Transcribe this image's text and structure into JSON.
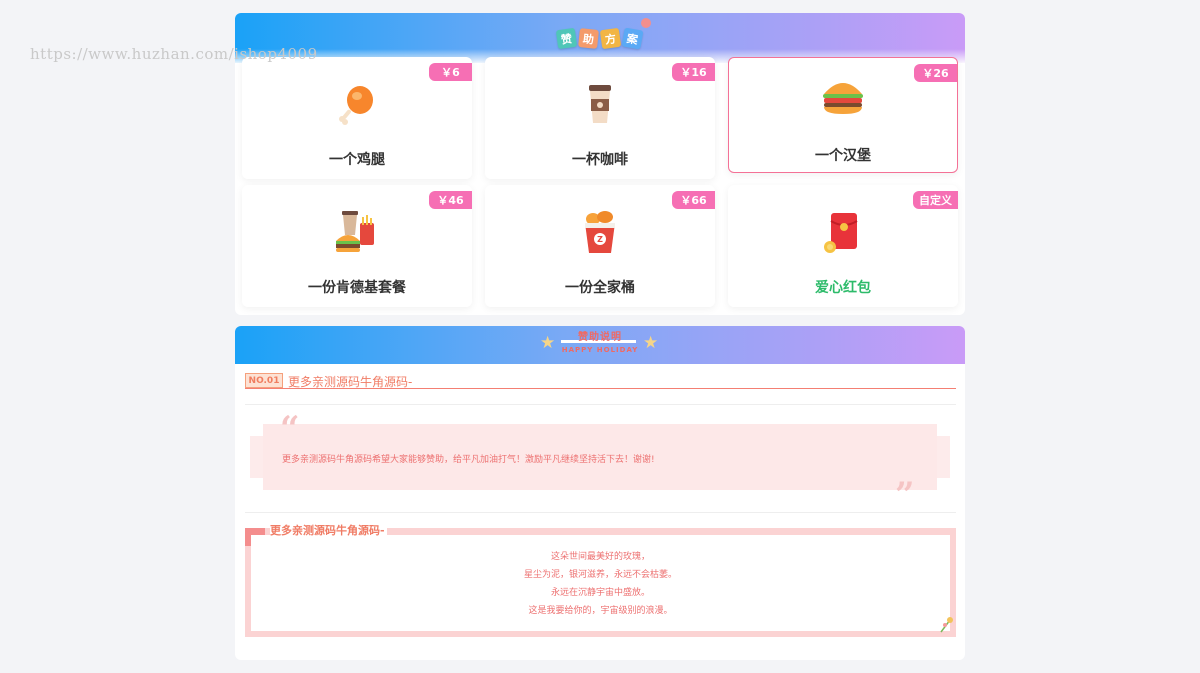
{
  "watermark": "https://www.huzhan.com/ishop4009",
  "sponsor": {
    "title_chars": [
      "赞",
      "助",
      "方",
      "案"
    ],
    "title_colors": [
      "#4fc6b8",
      "#f49b6b",
      "#f2b544",
      "#5aa9f5"
    ],
    "items": [
      {
        "name": "一个鸡腿",
        "price": "￥6",
        "icon": "chicken-leg-icon",
        "selected": false
      },
      {
        "name": "一杯咖啡",
        "price": "￥16",
        "icon": "coffee-cup-icon",
        "selected": false
      },
      {
        "name": "一个汉堡",
        "price": "￥26",
        "icon": "burger-icon",
        "selected": true
      },
      {
        "name": "一份肯德基套餐",
        "price": "￥46",
        "icon": "combo-meal-icon",
        "selected": false
      },
      {
        "name": "一份全家桶",
        "price": "￥66",
        "icon": "bucket-icon",
        "selected": false
      },
      {
        "name": "爱心红包",
        "price": "自定义",
        "icon": "red-envelope-icon",
        "selected": false
      }
    ]
  },
  "notes": {
    "heading": "赞助说明",
    "subheading": "HAPPY HOLIDAY",
    "no_badge": "NO.01",
    "no_text": "更多亲测源码牛角源码-",
    "quote_text": "更多亲测源码牛角源码希望大家能够赞助，给平凡加油打气！激励平凡继续坚持活下去！谢谢!",
    "poem_title": "更多亲测源码牛角源码-",
    "poem_lines": [
      "这朵世间最美好的玫瑰，",
      "星尘为泥，银河滋养，永远不会枯萎。",
      "永远在沉静宇宙中盛放。",
      "这是我要给你的，宇宙级别的浪漫。"
    ]
  },
  "colors": {
    "accent_pink": "#f66fb4",
    "selected_border": "#f47196",
    "text_red": "#ed7171",
    "green": "#2dbb6a"
  }
}
